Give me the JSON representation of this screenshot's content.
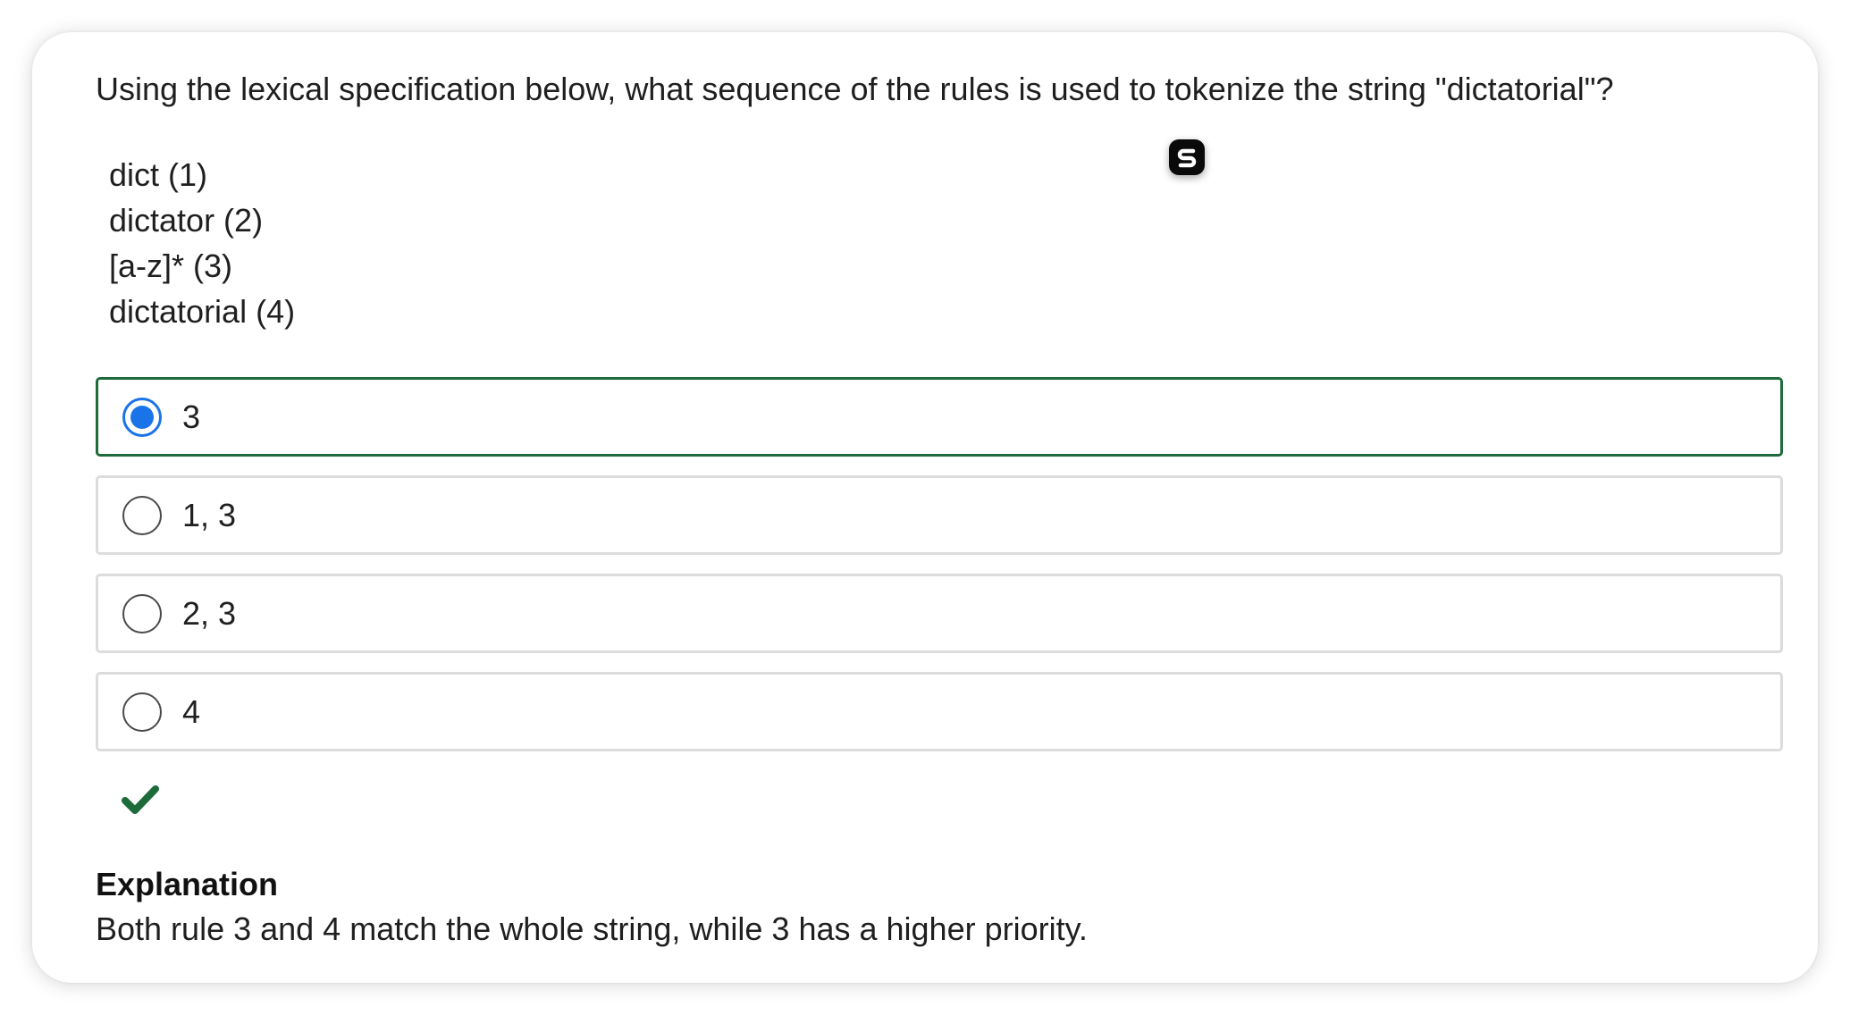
{
  "question": {
    "text": "Using the lexical specification below, what sequence of the rules is used to tokenize the string \"dictatorial\"?"
  },
  "rules": [
    "dict (1)",
    "dictator (2)",
    "[a-z]* (3)",
    "dictatorial (4)"
  ],
  "badge": {
    "icon": "s-logo-icon"
  },
  "options": [
    {
      "label": "3",
      "selected": true
    },
    {
      "label": "1, 3",
      "selected": false
    },
    {
      "label": "2, 3",
      "selected": false
    },
    {
      "label": "4",
      "selected": false
    }
  ],
  "result": {
    "icon": "check-icon",
    "status": "correct"
  },
  "explanation": {
    "title": "Explanation",
    "text": "Both rule 3 and 4 match the whole string, while 3 has a higher priority."
  },
  "colors": {
    "selected_border": "#1d6a3a",
    "radio_checked": "#1a73e8",
    "check": "#1d6a3a",
    "option_border": "#dcdcdc"
  }
}
